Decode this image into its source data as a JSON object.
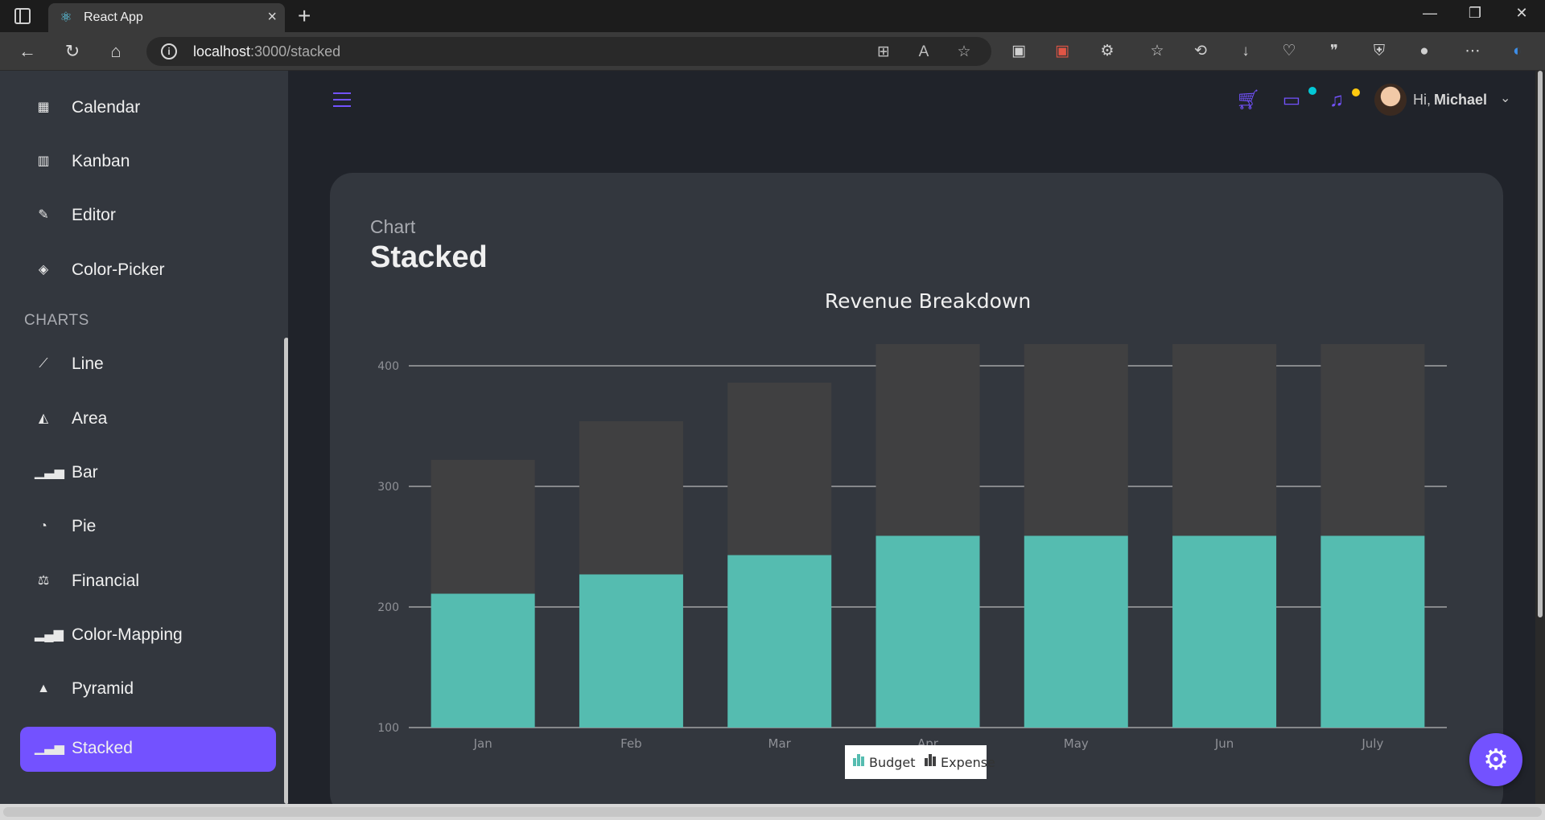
{
  "browser": {
    "tab_title": "React App",
    "url_host": "localhost",
    "url_path": ":3000/stacked",
    "window_controls": [
      "minimize",
      "restore",
      "close"
    ]
  },
  "sidebar": {
    "items_top": [
      {
        "label": "Calendar",
        "icon": "calendar-icon"
      },
      {
        "label": "Kanban",
        "icon": "kanban-icon"
      },
      {
        "label": "Editor",
        "icon": "editor-icon"
      },
      {
        "label": "Color-Picker",
        "icon": "color-picker-icon"
      }
    ],
    "section_label": "CHARTS",
    "chart_items": [
      {
        "label": "Line",
        "icon": "line-chart-icon"
      },
      {
        "label": "Area",
        "icon": "area-chart-icon"
      },
      {
        "label": "Bar",
        "icon": "bar-chart-icon"
      },
      {
        "label": "Pie",
        "icon": "pie-chart-icon"
      },
      {
        "label": "Financial",
        "icon": "financial-icon"
      },
      {
        "label": "Color-Mapping",
        "icon": "color-mapping-icon"
      },
      {
        "label": "Pyramid",
        "icon": "pyramid-icon"
      },
      {
        "label": "Stacked",
        "icon": "stacked-chart-icon",
        "active": true
      }
    ]
  },
  "navbar": {
    "greeting": "Hi,",
    "user_name": "Michael",
    "accent_color": "#7352ff",
    "cart_dot_color": "#03c9d7",
    "notification_dot_color": "#fec90f"
  },
  "page": {
    "subtitle": "Chart",
    "title": "Stacked"
  },
  "chart_data": {
    "type": "bar",
    "stacked": true,
    "title": "Revenue Breakdown",
    "categories": [
      "Jan",
      "Feb",
      "Mar",
      "Apr",
      "May",
      "Jun",
      "July"
    ],
    "series": [
      {
        "name": "Budget",
        "color": "#55bcb0",
        "values": [
          111,
          127,
          143,
          159,
          159,
          159,
          159
        ]
      },
      {
        "name": "Expense",
        "color": "#404041",
        "values": [
          111,
          127,
          143,
          159,
          159,
          159,
          159
        ]
      }
    ],
    "ylim": [
      100,
      400
    ],
    "yticks": [
      100,
      200,
      300,
      400
    ],
    "grid": true,
    "legend_position": "bottom-center"
  }
}
